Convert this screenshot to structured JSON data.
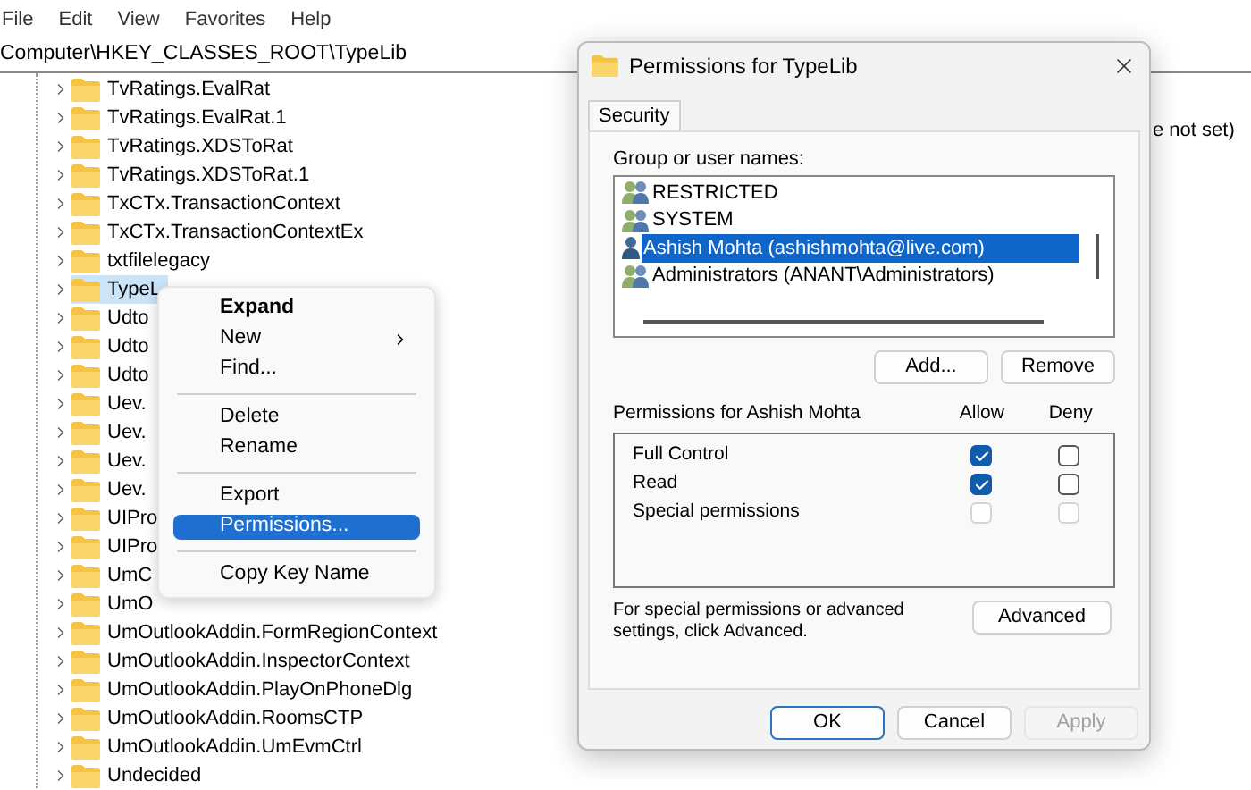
{
  "menu_bar": [
    "File",
    "Edit",
    "View",
    "Favorites",
    "Help"
  ],
  "address": "Computer\\HKEY_CLASSES_ROOT\\TypeLib",
  "tree": {
    "items": [
      {
        "label": "TvRatings.EvalRat",
        "selected": false
      },
      {
        "label": "TvRatings.EvalRat.1",
        "selected": false
      },
      {
        "label": "TvRatings.XDSToRat",
        "selected": false
      },
      {
        "label": "TvRatings.XDSToRat.1",
        "selected": false
      },
      {
        "label": "TxCTx.TransactionContext",
        "selected": false
      },
      {
        "label": "TxCTx.TransactionContextEx",
        "selected": false
      },
      {
        "label": "txtfilelegacy",
        "selected": false
      },
      {
        "label": "TypeL",
        "selected": true
      },
      {
        "label": "Udto",
        "selected": false
      },
      {
        "label": "Udto",
        "selected": false
      },
      {
        "label": "Udto",
        "selected": false
      },
      {
        "label": "Uev.",
        "selected": false
      },
      {
        "label": "Uev.",
        "selected": false
      },
      {
        "label": "Uev.",
        "selected": false
      },
      {
        "label": "Uev.",
        "selected": false
      },
      {
        "label": "UIPro",
        "selected": false
      },
      {
        "label": "UIPro",
        "selected": false
      },
      {
        "label": "UmC",
        "selected": false
      },
      {
        "label": "UmO",
        "selected": false
      },
      {
        "label": "UmOutlookAddin.FormRegionContext",
        "selected": false
      },
      {
        "label": "UmOutlookAddin.InspectorContext",
        "selected": false
      },
      {
        "label": "UmOutlookAddin.PlayOnPhoneDlg",
        "selected": false
      },
      {
        "label": "UmOutlookAddin.RoomsCTP",
        "selected": false
      },
      {
        "label": "UmOutlookAddin.UmEvmCtrl",
        "selected": false
      },
      {
        "label": "Undecided",
        "selected": false
      }
    ]
  },
  "right_pane": {
    "value_text": "e not set)"
  },
  "context_menu": {
    "items": [
      {
        "kind": "item",
        "label": "Expand",
        "bold": true,
        "submenu": false,
        "selected": false
      },
      {
        "kind": "item",
        "label": "New",
        "bold": false,
        "submenu": true,
        "selected": false
      },
      {
        "kind": "item",
        "label": "Find...",
        "bold": false,
        "submenu": false,
        "selected": false
      },
      {
        "kind": "separator"
      },
      {
        "kind": "item",
        "label": "Delete",
        "bold": false,
        "submenu": false,
        "selected": false
      },
      {
        "kind": "item",
        "label": "Rename",
        "bold": false,
        "submenu": false,
        "selected": false
      },
      {
        "kind": "separator"
      },
      {
        "kind": "item",
        "label": "Export",
        "bold": false,
        "submenu": false,
        "selected": false
      },
      {
        "kind": "item",
        "label": "Permissions...",
        "bold": false,
        "submenu": false,
        "selected": true
      },
      {
        "kind": "separator"
      },
      {
        "kind": "item",
        "label": "Copy Key Name",
        "bold": false,
        "submenu": false,
        "selected": false
      }
    ]
  },
  "dialog": {
    "title": "Permissions for TypeLib",
    "tabs": [
      {
        "label": "Security",
        "selected": true
      }
    ],
    "group_label": "Group or user names:",
    "users": [
      {
        "name": "RESTRICTED",
        "kind": "group",
        "selected": false
      },
      {
        "name": "SYSTEM",
        "kind": "group",
        "selected": false
      },
      {
        "name": "Ashish Mohta (ashishmohta@live.com)",
        "kind": "user",
        "selected": true
      },
      {
        "name": "Administrators (ANANT\\Administrators)",
        "kind": "group",
        "selected": false
      }
    ],
    "user_buttons": [
      "Add...",
      "Remove"
    ],
    "permissions_label": "Permissions for Ashish Mohta",
    "columns": [
      "Allow",
      "Deny"
    ],
    "permissions": [
      {
        "name": "Full Control",
        "allow": {
          "checked": true,
          "disabled": false
        },
        "deny": {
          "checked": false,
          "disabled": false
        }
      },
      {
        "name": "Read",
        "allow": {
          "checked": true,
          "disabled": false
        },
        "deny": {
          "checked": false,
          "disabled": false
        }
      },
      {
        "name": "Special permissions",
        "allow": {
          "checked": false,
          "disabled": true
        },
        "deny": {
          "checked": false,
          "disabled": true
        }
      }
    ],
    "note": "For special permissions or advanced settings, click Advanced.",
    "advanced_button": "Advanced",
    "footer_buttons": [
      {
        "label": "OK",
        "default": true,
        "disabled": false
      },
      {
        "label": "Cancel",
        "default": false,
        "disabled": false
      },
      {
        "label": "Apply",
        "default": false,
        "disabled": true
      }
    ]
  }
}
